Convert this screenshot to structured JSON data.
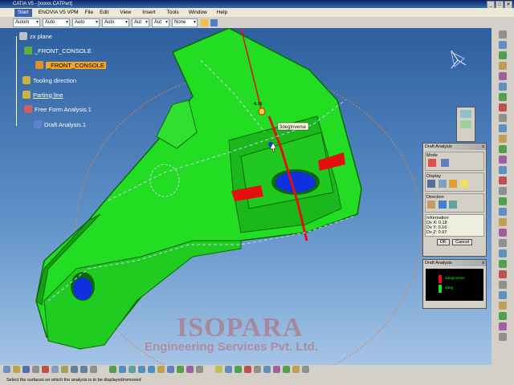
{
  "window": {
    "title": "CATIA V5 - [xxxxx.CATPart]",
    "buttons": [
      "_",
      "□",
      "✕"
    ]
  },
  "menu": {
    "start": "Start",
    "items": [
      "ENOVIA V5 VPM",
      "File",
      "Edit",
      "View",
      "Insert",
      "Tools",
      "Window",
      "Help"
    ]
  },
  "toolbar": {
    "combos": [
      "Autom",
      "Auto",
      "Auto",
      "Auto",
      "Aut",
      "Aut",
      "None"
    ]
  },
  "tree": {
    "items": [
      {
        "label": "zx plane",
        "icon": "plane-icon",
        "color": "#c0c0c0"
      },
      {
        "label": "_FRONT_CONSOLE",
        "icon": "part-icon",
        "color": "#60b040"
      },
      {
        "label": "_FRONT_CONSOLE",
        "icon": "body-icon",
        "color": "#e09030",
        "selected": true
      },
      {
        "label": "Tooling direction",
        "icon": "direction-icon",
        "color": "#d0b040"
      },
      {
        "label": "Parting line",
        "icon": "curve-icon",
        "color": "#d0b040"
      },
      {
        "label": "Free Form Analysis.1",
        "icon": "analysis-icon",
        "color": "#d06060"
      },
      {
        "label": "Draft Analysis.1",
        "icon": "draft-icon",
        "color": "#6080d0"
      }
    ]
  },
  "viewport": {
    "annotation_label": "3degInverse",
    "angle_readout": "4.36"
  },
  "draft_panel": {
    "title": "Draft Analysis",
    "close": "x",
    "mode_label": "Mode",
    "display_label": "Display",
    "direction_label": "Direction",
    "information_label": "Information",
    "info": [
      "Dx X: 0.18",
      "Dx Y: 0.16",
      "Dx Z: 0.97"
    ],
    "ok": "OK",
    "cancel": "Cancel"
  },
  "mini_panel": {
    "title": "Draft Analysis",
    "close": "x",
    "legend": [
      "3degInverse",
      "3deg"
    ]
  },
  "watermark": {
    "line1": "ISOPARA",
    "line2": "Engineering Services Pvt. Ltd."
  },
  "status": {
    "text": "Select the surfaces on which the analysis is to be displayed/removed"
  },
  "colors": {
    "part": "#22dd22",
    "draft_red": "#e41010",
    "draft_blue": "#1030e0",
    "selected": "#f5a623"
  }
}
